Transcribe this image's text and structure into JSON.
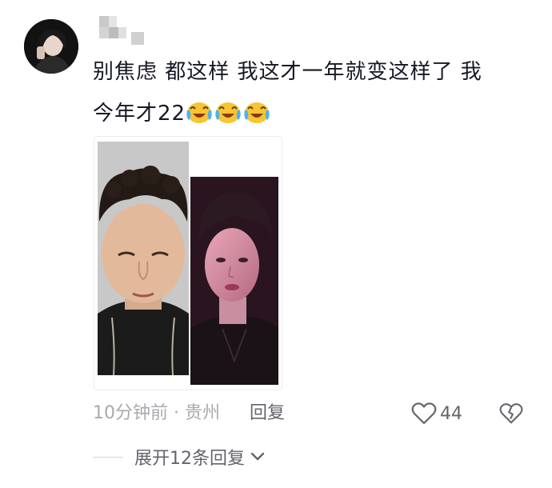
{
  "comment": {
    "text_line1": "别焦虑  都这样  我这才一年就变这样了 我",
    "text_line2": "今年才22",
    "emoji_names": [
      "cry-laugh-emoji",
      "cry-laugh-emoji",
      "cry-laugh-emoji"
    ],
    "time": "10分钟前",
    "separator": "·",
    "location": "贵州",
    "reply_label": "回复",
    "like_count": "44",
    "expand_replies_label": "展开12条回复"
  },
  "icons": {
    "like": "heart-outline-icon",
    "dislike": "broken-heart-icon",
    "expand": "chevron-down-icon"
  },
  "colors": {
    "primary_text": "#161823",
    "secondary_text": "#a9aaaf",
    "action_text": "#63656b"
  }
}
